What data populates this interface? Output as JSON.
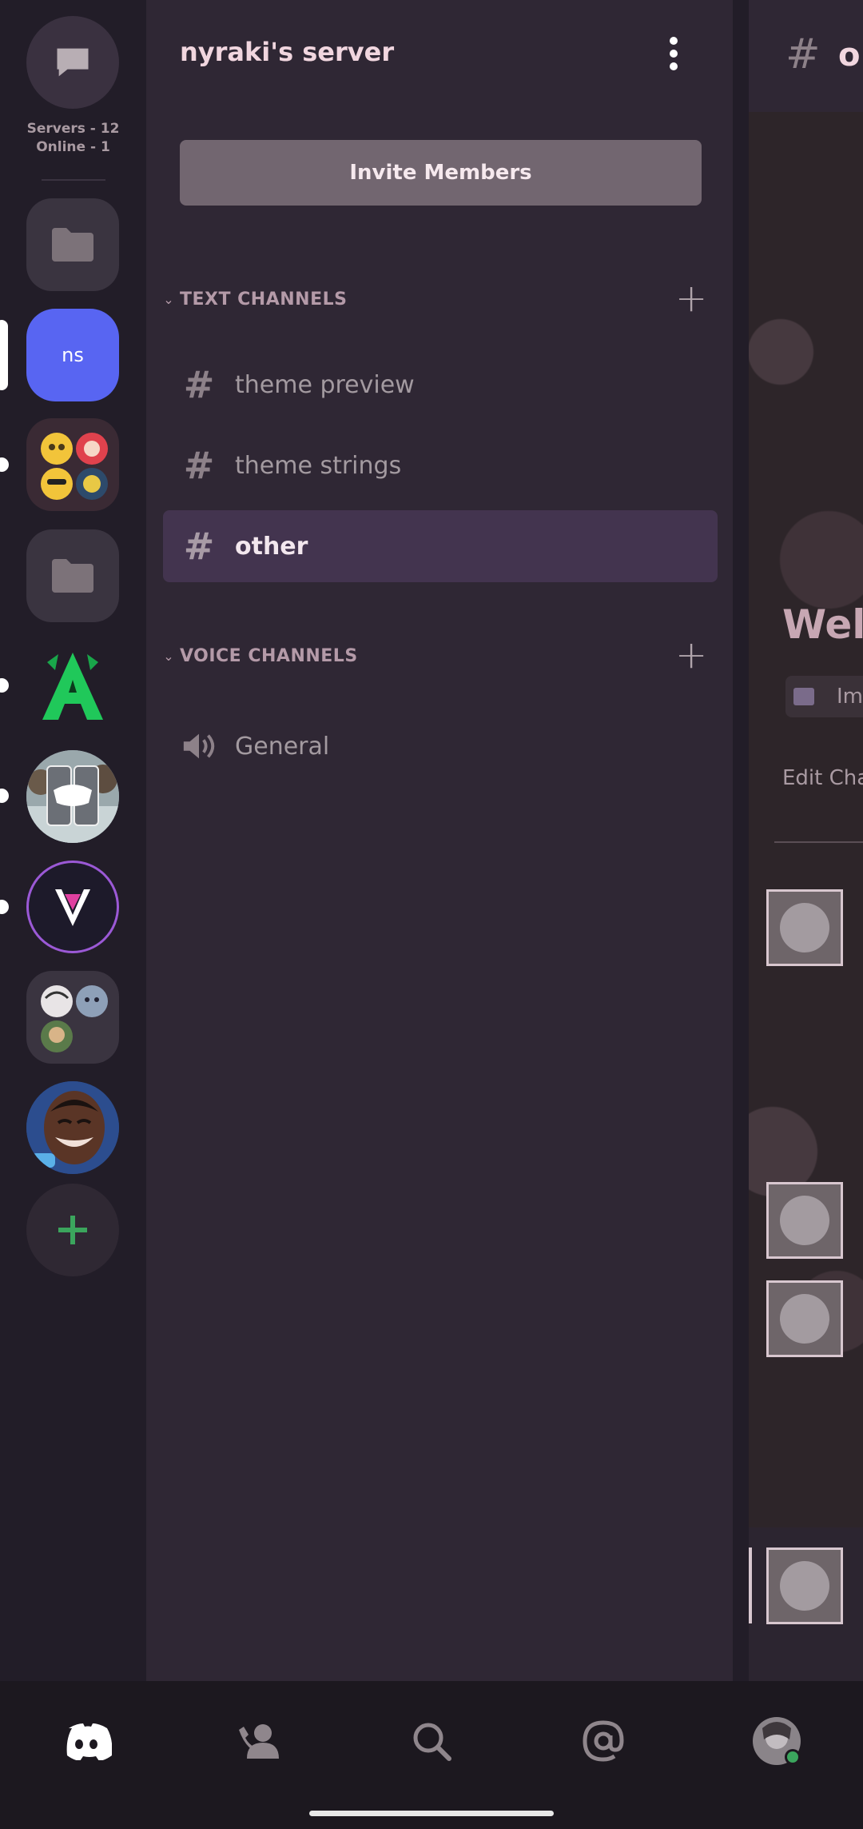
{
  "rail": {
    "servers_count": "Servers - 12",
    "online_count": "Online - 1",
    "items": [
      {
        "type": "dm",
        "icon": "chat-bubble-icon"
      },
      {
        "type": "folder",
        "icon": "folder-icon"
      },
      {
        "type": "server",
        "label": "ns",
        "selected": true
      },
      {
        "type": "server",
        "icon": "emoji-group-server-icon",
        "unread": true
      },
      {
        "type": "folder",
        "icon": "folder-icon"
      },
      {
        "type": "server",
        "icon": "green-a-server-icon",
        "unread": true
      },
      {
        "type": "server",
        "icon": "discord-phones-server-icon",
        "unread": true
      },
      {
        "type": "server",
        "icon": "v-logo-server-icon",
        "unread": true
      },
      {
        "type": "folder",
        "icon": "avatar-folder-icon"
      },
      {
        "type": "server",
        "icon": "laughing-person-server-icon"
      },
      {
        "type": "action",
        "icon": "add-server-icon"
      }
    ]
  },
  "server": {
    "name": "nyraki's server",
    "invite_label": "Invite Members"
  },
  "categories": [
    {
      "label": "TEXT CHANNELS",
      "channels": [
        {
          "label": "theme preview",
          "type": "text",
          "active": false
        },
        {
          "label": "theme strings",
          "type": "text",
          "active": false
        },
        {
          "label": "other",
          "type": "text",
          "active": true
        }
      ]
    },
    {
      "label": "VOICE CHANNELS",
      "channels": [
        {
          "label": "General",
          "type": "voice",
          "active": false
        }
      ]
    }
  ],
  "peek": {
    "hash": "#",
    "channel": "o",
    "welcome": "Welc",
    "chip": "Im",
    "edit": "Edit Cha"
  },
  "nav": {
    "items": [
      "discord-home-icon",
      "friends-icon",
      "search-icon",
      "mentions-icon",
      "profile-avatar-icon"
    ],
    "online_color": "#3ba55d"
  },
  "colors": {
    "accent_server": "#5865f2",
    "active_channel": "#43344f",
    "add_green": "#3ba55d"
  }
}
